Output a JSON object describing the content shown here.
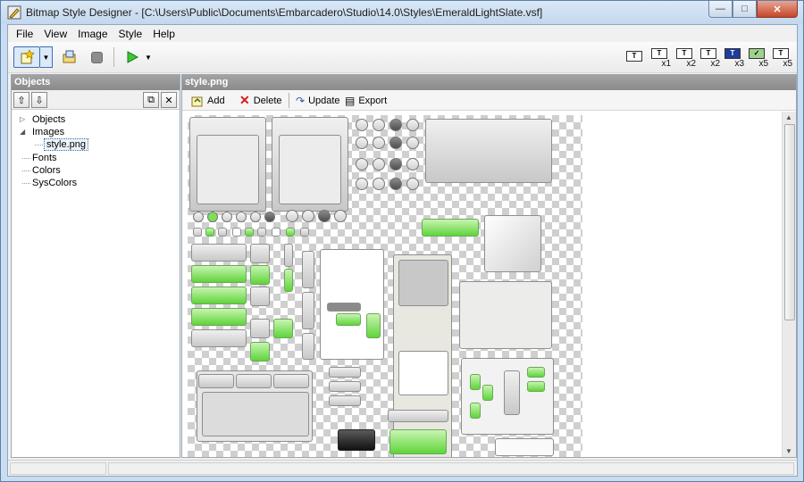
{
  "window": {
    "title": "Bitmap Style Designer - [C:\\Users\\Public\\Documents\\Embarcadero\\Studio\\14.0\\Styles\\EmeraldLightSlate.vsf]",
    "controls": [
      "minimize-icon",
      "maximize-icon",
      "close-icon"
    ]
  },
  "menu": [
    "File",
    "View",
    "Image",
    "Style",
    "Help"
  ],
  "toolbar": {
    "buttons": [
      "new-object-icon",
      "open-icon",
      "stop-icon",
      "run-icon"
    ],
    "scale_labels": [
      "x1",
      "x2",
      "x2",
      "x3",
      "x5",
      "x5"
    ]
  },
  "objects_panel": {
    "header": "Objects",
    "tree": [
      {
        "label": "Objects",
        "expandable": true
      },
      {
        "label": "Images",
        "expanded": true,
        "children": [
          "style.png"
        ]
      },
      {
        "label": "Fonts"
      },
      {
        "label": "Colors"
      },
      {
        "label": "SysColors"
      }
    ]
  },
  "image_panel": {
    "header": "style.png",
    "tools": [
      "Add",
      "Delete",
      "Update",
      "Export"
    ]
  },
  "colors": {
    "accent_green": "#5fd43a",
    "panel_header": "#8a8a8a"
  }
}
